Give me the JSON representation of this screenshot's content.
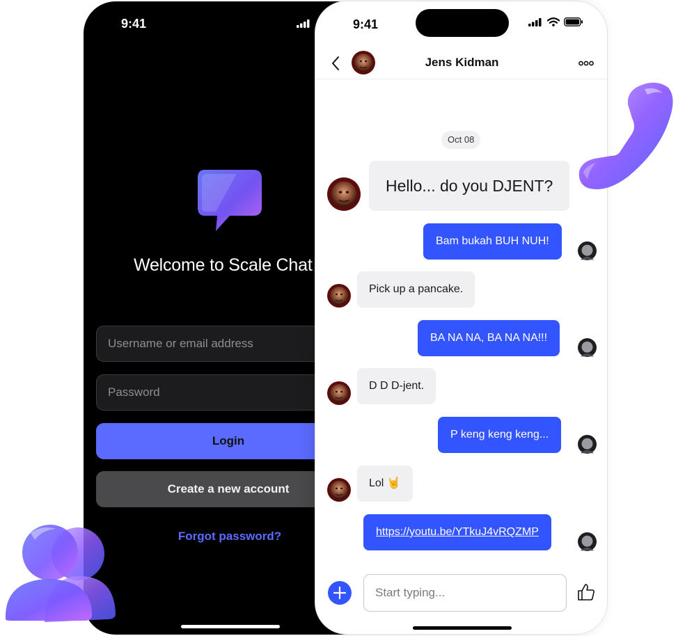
{
  "login_screen": {
    "status_time": "9:41",
    "welcome_title": "Welcome to Scale Chat",
    "username_placeholder": "Username or email address",
    "password_placeholder": "Password",
    "login_label": "Login",
    "create_account_label": "Create a new account",
    "forgot_password_label": "Forgot password?"
  },
  "chat_screen": {
    "status_time": "9:41",
    "contact_name": "Jens Kidman",
    "date_label": "Oct 08",
    "messages": [
      {
        "from": "contact",
        "text": "Hello... do you DJENT?"
      },
      {
        "from": "me",
        "text": "Bam bukah BUH NUH!"
      },
      {
        "from": "contact",
        "text": "Pick up a pancake."
      },
      {
        "from": "me",
        "text": "BA NA NA, BA NA NA!!!"
      },
      {
        "from": "contact",
        "text": "D D D-jent."
      },
      {
        "from": "me",
        "text": "P keng keng keng..."
      },
      {
        "from": "contact",
        "text": "Lol 🤘"
      },
      {
        "from": "me",
        "text": "https://youtu.be/YTkuJ4vRQZMP"
      }
    ],
    "composer_placeholder": "Start typing..."
  },
  "icons": {
    "back": "chevron-left-icon",
    "more": "more-horizontal-icon",
    "add": "plus-circle-icon",
    "like": "thumbs-up-icon",
    "signal": "signal-icon",
    "wifi": "wifi-icon",
    "battery": "battery-icon",
    "logo": "chat-bubble-icon",
    "deco_phone": "phone-handset-icon",
    "deco_users": "users-icon"
  },
  "colors": {
    "accent": "#3355ff",
    "login_button": "#5b6bff",
    "dark_bg": "#000000",
    "incoming_bubble": "#f0f0f2"
  }
}
